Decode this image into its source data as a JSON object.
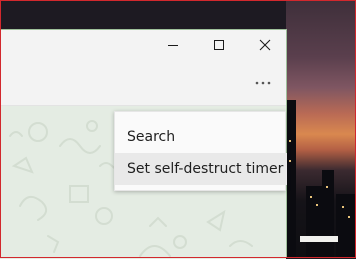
{
  "window": {
    "controls": {
      "minimize_icon": "minimize-icon",
      "maximize_icon": "maximize-icon",
      "close_icon": "close-icon"
    },
    "header": {
      "more_icon": "more-horizontal-icon",
      "more_label": "⋯"
    }
  },
  "menu": {
    "items": [
      {
        "label": "Search"
      },
      {
        "label": "Set self-destruct timer"
      }
    ]
  },
  "colors": {
    "window_bg": "#f3f3f3",
    "chat_bg": "#e4ece3",
    "menu_bg": "#fafafa",
    "menu_hover": "#e9e9e9",
    "screenshot_frame": "#d2282d"
  }
}
